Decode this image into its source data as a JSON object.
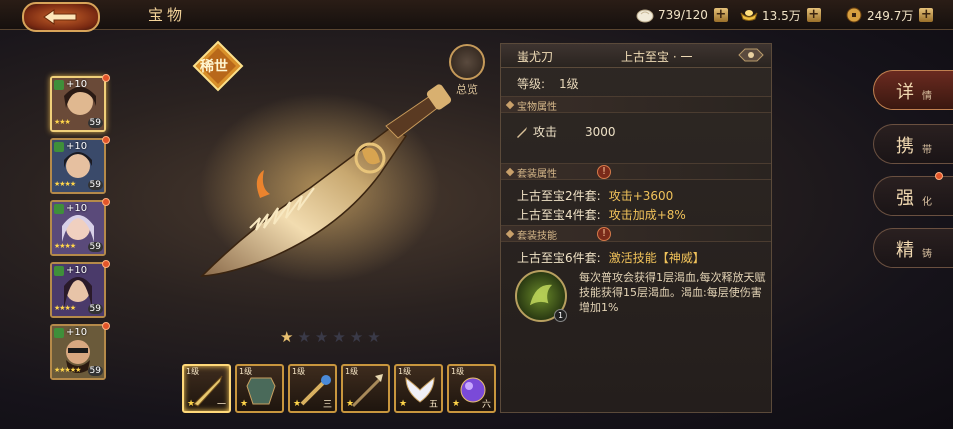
{
  "header": {
    "title": "宝物",
    "resources": [
      {
        "name": "bun",
        "value": "739/120"
      },
      {
        "name": "ingot",
        "value": "13.5万"
      },
      {
        "name": "coin",
        "value": "249.7万"
      }
    ]
  },
  "heroes": [
    {
      "plus": "+10",
      "level": "59"
    },
    {
      "plus": "+10",
      "level": "59"
    },
    {
      "plus": "+10",
      "level": "59"
    },
    {
      "plus": "+10",
      "level": "59"
    },
    {
      "plus": "+10",
      "level": "59"
    }
  ],
  "treasure": {
    "rarity_badge": "稀世",
    "overview_label": "总览",
    "stars_filled": 1,
    "stars_total": 6,
    "name": "蚩尤刀",
    "tier": "上古至宝 · 一",
    "level_label": "等级:",
    "level_value": "1级"
  },
  "sections": {
    "treasure_attr": "宝物属性",
    "set_attr": "套装属性",
    "set_skill": "套装技能"
  },
  "attributes": [
    {
      "label": "攻击",
      "value": "3000"
    }
  ],
  "set_bonuses": [
    {
      "label": "上古至宝2件套:",
      "effect": "攻击+3600"
    },
    {
      "label": "上古至宝4件套:",
      "effect": "攻击加成+8%"
    },
    {
      "label": "上古至宝6件套:",
      "effect": "激活技能【神威】"
    }
  ],
  "skill": {
    "icon_count": "1",
    "description": "每次普攻会获得1层渴血,每次释放天赋技能获得15层渴血。渴血:每层使伤害增加1%"
  },
  "slots": [
    {
      "level": "1级",
      "num": "一"
    },
    {
      "level": "1级",
      "num": ""
    },
    {
      "level": "1级",
      "num": "三"
    },
    {
      "level": "1级",
      "num": ""
    },
    {
      "level": "1级",
      "num": "五"
    },
    {
      "level": "1级",
      "num": "六"
    }
  ],
  "right_tabs": [
    {
      "big": "详",
      "small": "情"
    },
    {
      "big": "携",
      "small": "带"
    },
    {
      "big": "强",
      "small": "化"
    },
    {
      "big": "精",
      "small": "铸"
    }
  ]
}
